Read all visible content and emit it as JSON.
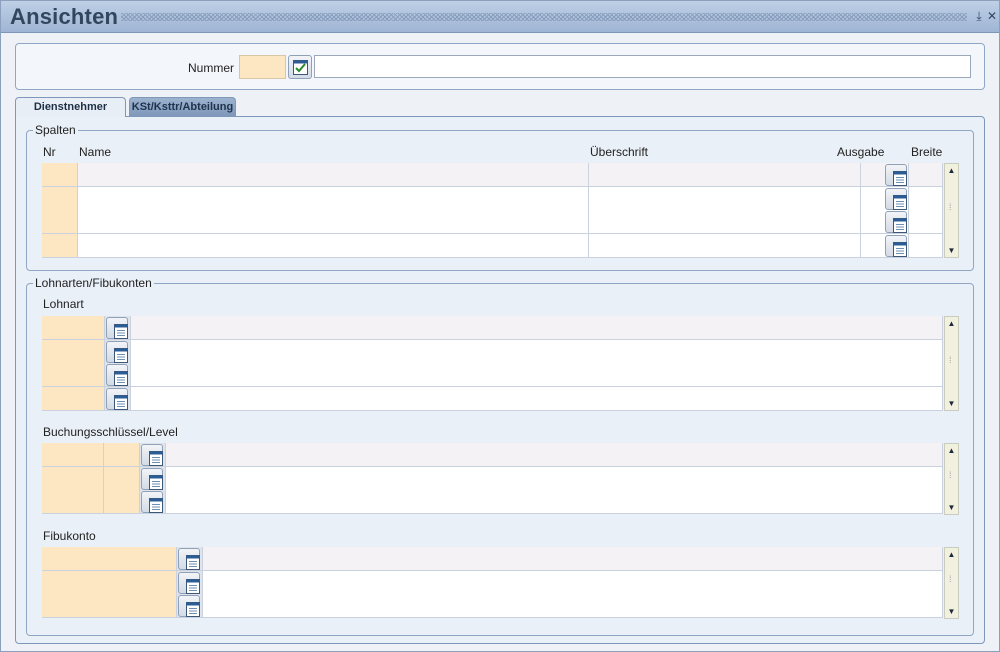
{
  "window": {
    "title": "Ansichten",
    "min_icon": "minimize-icon",
    "close_icon": "close-icon"
  },
  "header": {
    "nummer_label": "Nummer",
    "nummer_value": "",
    "description_value": ""
  },
  "tabs": [
    {
      "label": "Dienstnehmer",
      "active": true
    },
    {
      "label": "KSt/Ksttr/Abteilung",
      "active": false
    }
  ],
  "spalten": {
    "legend": "Spalten",
    "columns": {
      "nr": "Nr",
      "name": "Name",
      "ueberschrift": "Überschrift",
      "ausgabe": "Ausgabe",
      "breite": "Breite"
    }
  },
  "lohnarten": {
    "legend": "Lohnarten/Fibukonten",
    "lohnart_label": "Lohnart",
    "buchung_label": "Buchungsschlüssel/Level",
    "fibukonto_label": "Fibukonto"
  },
  "colors": {
    "field_yellow": "#fde7c2",
    "title_text": "#33465f",
    "tab_inactive": "#8ea6c6"
  }
}
